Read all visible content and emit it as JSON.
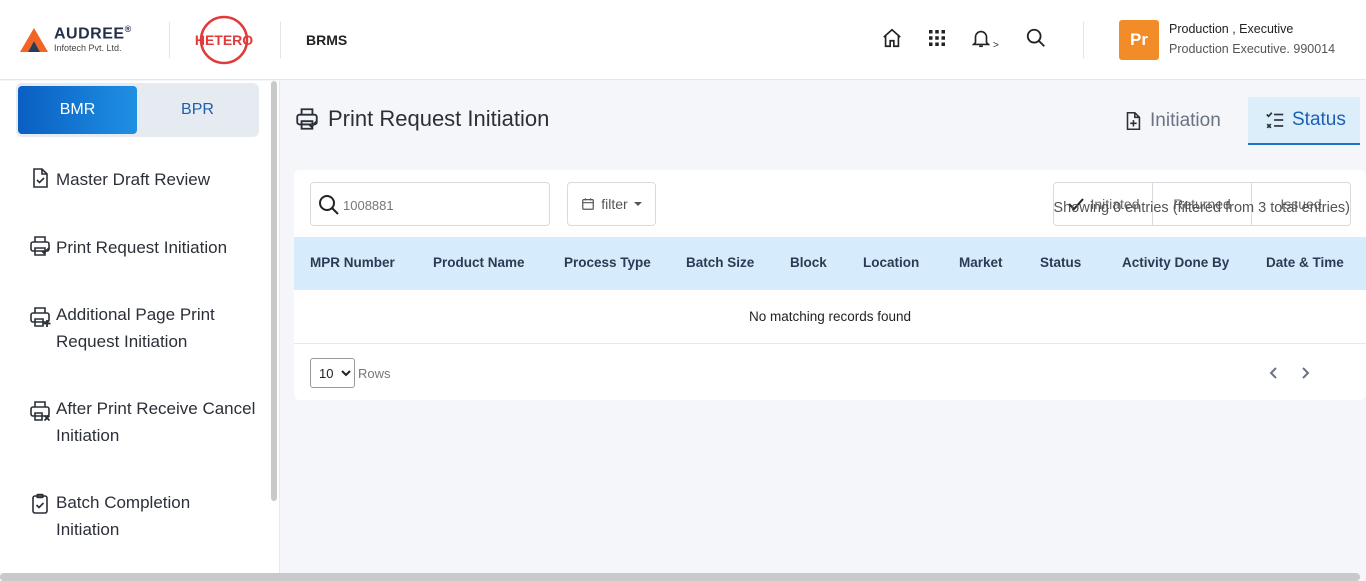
{
  "header": {
    "logo_brand": "AUDREE",
    "logo_reg": "®",
    "logo_sub": "Infotech Pvt. Ltd.",
    "partner_logo": "HETERO",
    "app_name": "BRMS",
    "icons": [
      "home-icon",
      "apps-grid-icon",
      "bell-icon",
      "search-icon"
    ],
    "notif_caret": ">",
    "avatar_initials": "Pr",
    "user_name": "Production , Executive",
    "user_role": "Production Executive. 990014",
    "colors": {
      "avatar": "#f28c28",
      "hetero_red": "#e03a3a",
      "audree_orange": "#f26522"
    }
  },
  "sidebar": {
    "toggle": {
      "active": "BMR",
      "inactive": "BPR"
    },
    "items": [
      {
        "label": "Master Draft Review",
        "icon": "document-check-icon"
      },
      {
        "label": "Print Request Initiation",
        "icon": "printer-check-icon"
      },
      {
        "label_line1": "Additional Page Print",
        "label_line2": "Request Initiation",
        "icon": "printer-plus-icon"
      },
      {
        "label_line1": "After Print Receive Cancel",
        "label_line2": "Initiation",
        "icon": "printer-cancel-icon"
      },
      {
        "label_line1": "Batch Completion",
        "label_line2": "Initiation",
        "icon": "clipboard-check-icon"
      }
    ]
  },
  "main": {
    "title": "Print Request Initiation",
    "tabs": {
      "initiation": "Initiation",
      "status": "Status"
    },
    "search": {
      "value": "1008881",
      "placeholder": "Search"
    },
    "filter_label": "filter",
    "status_filters": [
      "Initiated",
      "Returned",
      "Issued"
    ],
    "showing": "Showing 0 entries (filtered from 3 total entries)",
    "columns": [
      "MPR Number",
      "Product Name",
      "Process Type",
      "Batch Size",
      "Block",
      "Location",
      "Market",
      "Status",
      "Activity Done By",
      "Date & Time"
    ],
    "empty_message": "No matching records found",
    "rows_per_page": "10",
    "rows_options": [
      "10"
    ],
    "rows_label": "Rows",
    "colors": {
      "accent": "#1d75c9",
      "table_header": "#d6ebfb",
      "tab_active_bg": "#dbeefa"
    }
  }
}
